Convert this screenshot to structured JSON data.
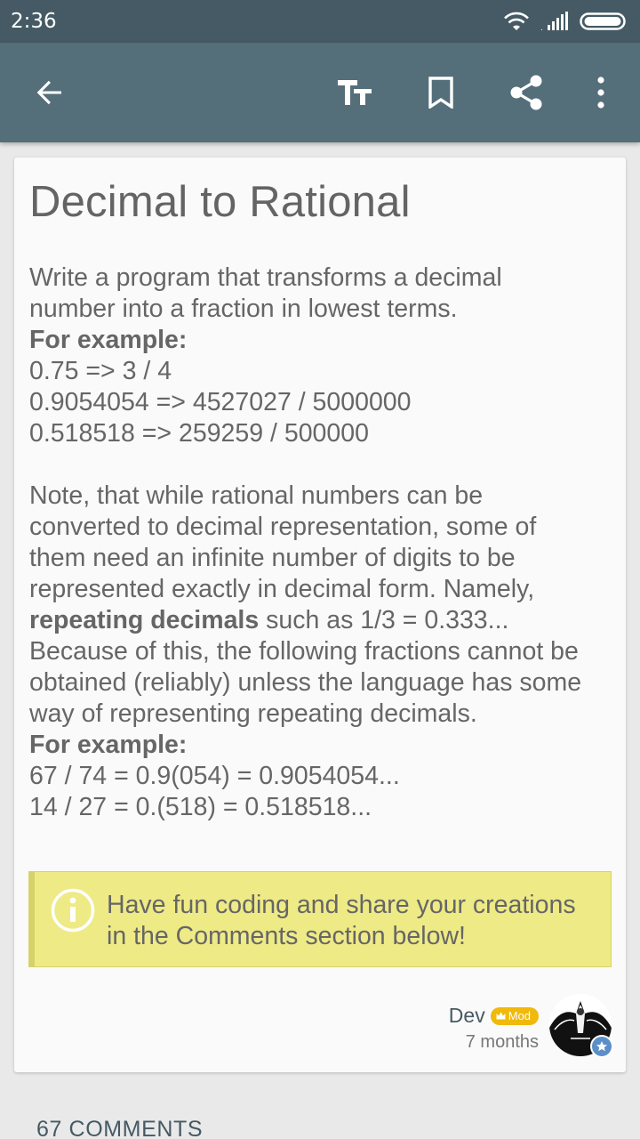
{
  "status_bar": {
    "time": "2:36",
    "icons": [
      "wifi-icon",
      "signal-icon",
      "battery-icon"
    ]
  },
  "app_bar": {
    "actions": [
      "back-arrow-icon",
      "text-size-icon",
      "bookmark-icon",
      "share-icon",
      "more-vert-icon"
    ],
    "color": "#546e7a"
  },
  "lesson": {
    "title": "Decimal to Rational",
    "intro_line_1": "Write a program that transforms a decimal",
    "intro_line_2": "number into a fraction in lowest terms.",
    "example_heading_1": "For example:",
    "example_1": "0.75 => 3 / 4",
    "example_2": "0.9054054 => 4527027 / 5000000",
    "example_3": "0.518518 => 259259 / 500000",
    "note_line_1": "Note, that while rational numbers can be",
    "note_line_2": "converted to decimal representation, some of",
    "note_line_3": "them need an infinite number of digits to be",
    "note_line_4": "represented exactly in decimal form. Namely,",
    "note_bold": "repeating decimals",
    "note_line_5_rest": " such as 1/3 = 0.333...",
    "note_line_6": "Because of this, the following fractions cannot be",
    "note_line_7": "obtained (reliably) unless the language has some",
    "note_line_8": "way of representing repeating decimals.",
    "example_heading_2": "For example:",
    "example_4": "67 / 74 = 0.9(054) = 0.9054054...",
    "example_5": "14 / 27 = 0.(518) = 0.518518..."
  },
  "info_box": {
    "icon": "info-icon",
    "line_1": "Have fun coding and share your creations",
    "line_2": "in the Comments section below!",
    "background": "#eeea86"
  },
  "author": {
    "name": "Dev",
    "badge": "Mod",
    "time": "7 months"
  },
  "comments": {
    "label": "67 COMMENTS"
  }
}
